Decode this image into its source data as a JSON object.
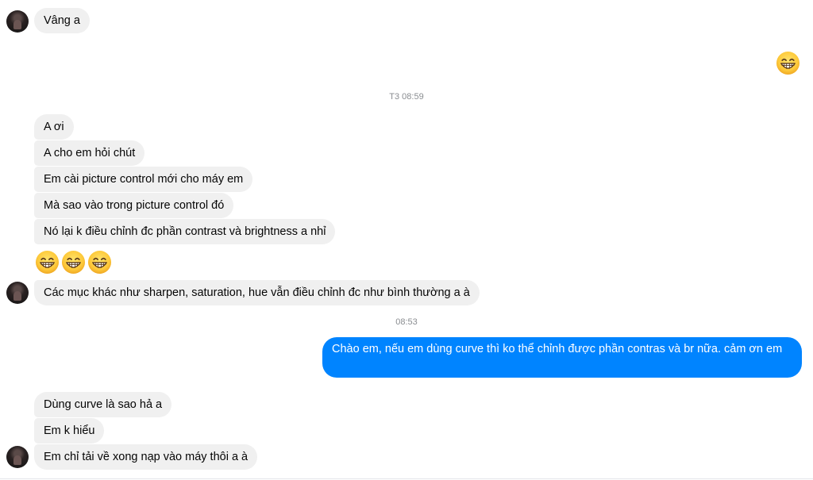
{
  "messages": {
    "m1": "Vâng a",
    "m2": "A ơi",
    "m3": "A cho em hỏi chút",
    "m4": "Em cài picture control mới cho máy em",
    "m5": "Mà sao vào trong picture control đó",
    "m6": "Nó lại k điều chỉnh đc phần contrast và brightness a nhỉ",
    "m7": "Các mục khác như sharpen, saturation, hue vẫn điều chỉnh đc như bình thường a à",
    "m8": "Chào em, nếu em dùng curve thì ko thể chỉnh được phần contras và br nữa. cảm ơn em",
    "m9": "Dùng curve là sao hả a",
    "m10": "Em k hiểu",
    "m11": "Em chỉ tải về xong nạp vào máy thôi a à"
  },
  "timestamps": {
    "t1": "T3 08:59",
    "t2": "08:53"
  },
  "icons": {
    "emoji": "grinning-face-with-smiling-eyes",
    "avatar": "contact-avatar"
  },
  "colors": {
    "incoming_bubble": "#f0f0f0",
    "outgoing_bubble": "#0084ff",
    "timestamp_text": "#8a8d91"
  }
}
